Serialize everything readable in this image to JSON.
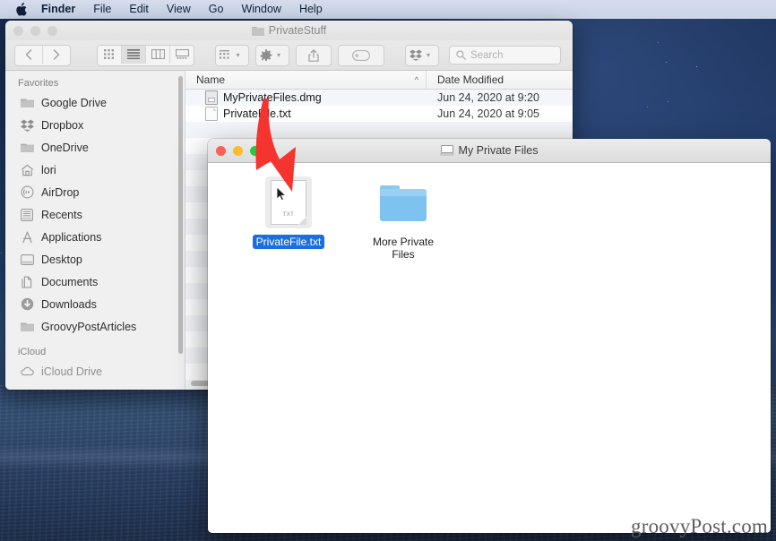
{
  "menubar": {
    "apple_icon": "apple-logo-icon",
    "items": [
      {
        "label": "Finder",
        "bold": true
      },
      {
        "label": "File",
        "bold": false
      },
      {
        "label": "Edit",
        "bold": false
      },
      {
        "label": "View",
        "bold": false
      },
      {
        "label": "Go",
        "bold": false
      },
      {
        "label": "Window",
        "bold": false
      },
      {
        "label": "Help",
        "bold": false
      }
    ]
  },
  "finder_window": {
    "title": "PrivateStuff",
    "title_icon": "folder-icon",
    "traffic_lights": [
      "close",
      "minimize",
      "zoom"
    ],
    "toolbar": {
      "back_icon": "chevron-left-icon",
      "forward_icon": "chevron-right-icon",
      "view_icon_grid": "icon-view-icon",
      "view_list": "list-view-icon",
      "view_column": "column-view-icon",
      "view_gallery": "gallery-view-icon",
      "arrange_icon": "arrange-by-icon",
      "action_icon": "gear-icon",
      "share_icon": "share-icon",
      "tags_icon": "tag-icon",
      "dropbox_icon": "dropbox-icon",
      "search_placeholder": "Search",
      "search_value": "",
      "search_icon": "search-icon"
    },
    "sidebar": {
      "sections": [
        {
          "header": "Favorites",
          "items": [
            {
              "label": "Google Drive",
              "icon": "folder-icon"
            },
            {
              "label": "Dropbox",
              "icon": "dropbox-icon"
            },
            {
              "label": "OneDrive",
              "icon": "folder-icon"
            },
            {
              "label": "lori",
              "icon": "home-icon"
            },
            {
              "label": "AirDrop",
              "icon": "airdrop-icon"
            },
            {
              "label": "Recents",
              "icon": "recents-icon"
            },
            {
              "label": "Applications",
              "icon": "applications-icon"
            },
            {
              "label": "Desktop",
              "icon": "desktop-icon"
            },
            {
              "label": "Documents",
              "icon": "documents-icon"
            },
            {
              "label": "Downloads",
              "icon": "downloads-icon"
            },
            {
              "label": "GroovyPostArticles",
              "icon": "folder-icon"
            }
          ]
        },
        {
          "header": "iCloud",
          "items": []
        }
      ]
    },
    "file_list": {
      "columns": {
        "name": "Name",
        "date_modified": "Date Modified"
      },
      "sort_caret": "^",
      "rows": [
        {
          "name": "MyPrivateFiles.dmg",
          "date_modified": "Jun 24, 2020 at 9:20",
          "icon": "disk-image-icon"
        },
        {
          "name": "PrivateFile.txt",
          "date_modified": "Jun 24, 2020 at 9:05",
          "icon": "text-document-icon"
        }
      ]
    }
  },
  "front_window": {
    "title": "My Private Files",
    "title_icon": "disk-volume-icon",
    "traffic_lights": [
      "close",
      "minimize",
      "zoom"
    ],
    "items": [
      {
        "label": "PrivateFile.txt",
        "icon": "text-document-icon",
        "badge": "TXT",
        "selected": true
      },
      {
        "label": "More Private Files",
        "icon": "folder-icon",
        "selected": false
      }
    ]
  },
  "annotation": {
    "arrow_icon": "red-down-arrow-annotation",
    "color": "#f5332f"
  },
  "watermark": {
    "text": "groovyPost.com"
  },
  "colors": {
    "selection_blue": "#1a6fe0",
    "folder_blue": "#7ec3ef",
    "menubar": "#d0daec",
    "desktop_top": "#1d3560",
    "desktop_bottom": "#2b4369"
  }
}
